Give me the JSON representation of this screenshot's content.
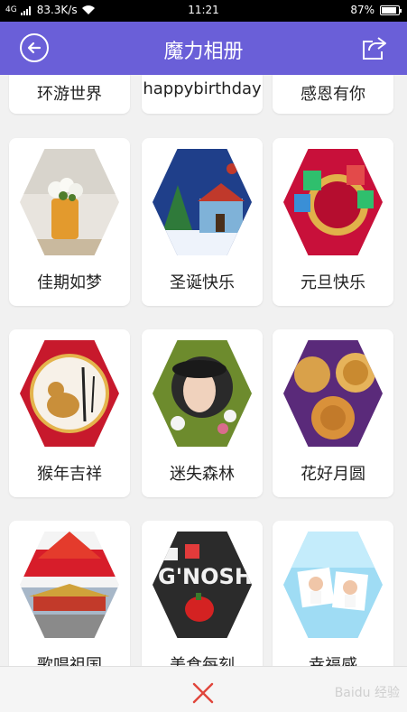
{
  "status": {
    "network_speed": "83.3K/s",
    "time": "11:21",
    "battery_percent": "87%",
    "battery_level": 0.87,
    "signal_label": "4G"
  },
  "header": {
    "title": "魔力相册",
    "back_icon": "back-circle-arrow-icon",
    "share_icon": "share-export-icon",
    "bg_color": "#6a5fd8"
  },
  "albums": {
    "top_row": [
      "环游世界",
      "happybirthday",
      "感恩有你"
    ],
    "items": [
      {
        "label": "佳期如梦"
      },
      {
        "label": "圣诞快乐"
      },
      {
        "label": "元旦快乐"
      },
      {
        "label": "猴年吉祥"
      },
      {
        "label": "迷失森林"
      },
      {
        "label": "花好月圆"
      },
      {
        "label": "歌唱祖国"
      },
      {
        "label": "美食newline"
      },
      {
        "label": "幸福感"
      }
    ]
  },
  "bottom": {
    "close_icon": "close-x-icon",
    "watermark": "Baidu 经验"
  }
}
